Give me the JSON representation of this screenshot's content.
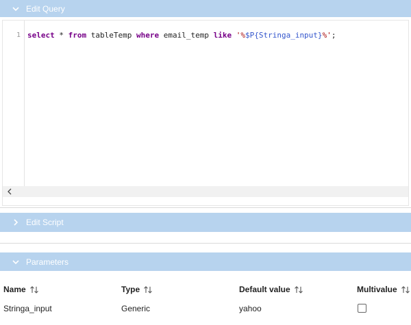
{
  "sections": {
    "edit_query": {
      "title": "Edit Query",
      "icon": "chevron-down-icon"
    },
    "edit_script": {
      "title": "Edit Script",
      "icon": "chevron-right-icon"
    },
    "parameters": {
      "title": "Parameters",
      "icon": "chevron-down-icon"
    }
  },
  "editor": {
    "line_number": "1",
    "tokens": {
      "kw_select": "select",
      "t1": " * ",
      "kw_from": "from",
      "t2": " tableTemp ",
      "kw_where": "where",
      "t3": " email_temp ",
      "kw_like": "like",
      "t4": " ",
      "str_open": "'%",
      "param": "$P{Stringa_input}",
      "str_close": "%'",
      "semicolon": ";"
    }
  },
  "table": {
    "columns": [
      "Name",
      "Type",
      "Default value",
      "Multivalue"
    ],
    "rows": [
      {
        "name": "Stringa_input",
        "type": "Generic",
        "default_value": "yahoo",
        "multivalue": false
      }
    ]
  },
  "colors": {
    "header_bg": "#b7d3ee",
    "keyword": "#770088",
    "string": "#aa1111",
    "param": "#3355cc"
  }
}
